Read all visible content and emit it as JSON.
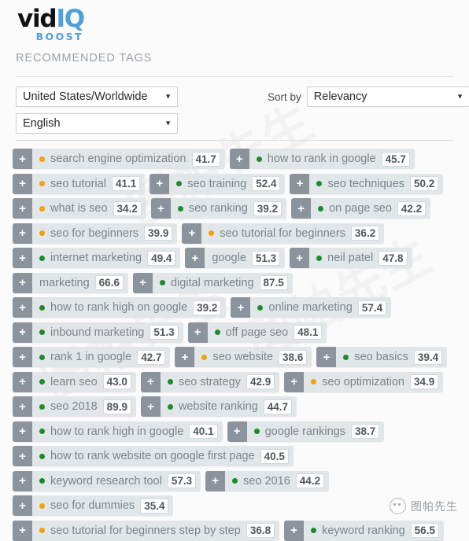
{
  "brand": {
    "logo_vid": "vid",
    "logo_iq": "IQ",
    "logo_boost": "BOOST",
    "accent_color": "#4f9fda"
  },
  "section": {
    "title": "RECOMMENDED TAGS"
  },
  "filters": {
    "region_value": "United States/Worldwide",
    "language_value": "English",
    "sort_label": "Sort by",
    "sort_value": "Relevancy",
    "caret_icon": "chevron-down-icon"
  },
  "tag_colors": {
    "green": "#1d8a2b",
    "orange": "#f0a010",
    "chip_bg": "#e1e6e9",
    "add_bg": "#8b949c"
  },
  "add_icon_glyph": "+",
  "tag_rows": [
    [
      {
        "label": "search engine optimization",
        "score": "41.7",
        "dot": "orange"
      },
      {
        "label": "how to rank in google",
        "score": "45.7",
        "dot": "green"
      }
    ],
    [
      {
        "label": "seo tutorial",
        "score": "41.1",
        "dot": "orange"
      },
      {
        "label": "seo training",
        "score": "52.4",
        "dot": "green"
      },
      {
        "label": "seo techniques",
        "score": "50.2",
        "dot": "green"
      }
    ],
    [
      {
        "label": "what is seo",
        "score": "34.2",
        "dot": "orange"
      },
      {
        "label": "seo ranking",
        "score": "39.2",
        "dot": "green"
      },
      {
        "label": "on page seo",
        "score": "42.2",
        "dot": "green"
      }
    ],
    [
      {
        "label": "seo for beginners",
        "score": "39.9",
        "dot": "orange"
      },
      {
        "label": "seo tutorial for beginners",
        "score": "36.2",
        "dot": "orange"
      }
    ],
    [
      {
        "label": "internet marketing",
        "score": "49.4",
        "dot": "green"
      },
      {
        "label": "google",
        "score": "51.3",
        "dot": "none"
      },
      {
        "label": "neil patel",
        "score": "47.8",
        "dot": "green"
      }
    ],
    [
      {
        "label": "marketing",
        "score": "66.6",
        "dot": "none"
      },
      {
        "label": "digital marketing",
        "score": "87.5",
        "dot": "green"
      }
    ],
    [
      {
        "label": "how to rank high on google",
        "score": "39.2",
        "dot": "green"
      },
      {
        "label": "online marketing",
        "score": "57.4",
        "dot": "green"
      }
    ],
    [
      {
        "label": "inbound marketing",
        "score": "51.3",
        "dot": "green"
      },
      {
        "label": "off page seo",
        "score": "48.1",
        "dot": "green"
      }
    ],
    [
      {
        "label": "rank 1 in google",
        "score": "42.7",
        "dot": "green"
      },
      {
        "label": "seo website",
        "score": "38.6",
        "dot": "orange"
      },
      {
        "label": "seo basics",
        "score": "39.4",
        "dot": "green"
      }
    ],
    [
      {
        "label": "learn seo",
        "score": "43.0",
        "dot": "green"
      },
      {
        "label": "seo strategy",
        "score": "42.9",
        "dot": "green"
      },
      {
        "label": "seo optimization",
        "score": "34.9",
        "dot": "orange"
      }
    ],
    [
      {
        "label": "seo 2018",
        "score": "89.9",
        "dot": "green"
      },
      {
        "label": "website ranking",
        "score": "44.7",
        "dot": "green"
      }
    ],
    [
      {
        "label": "how to rank high in google",
        "score": "40.1",
        "dot": "green"
      },
      {
        "label": "google rankings",
        "score": "38.7",
        "dot": "green"
      }
    ],
    [
      {
        "label": "how to rank website on google first page",
        "score": "40.5",
        "dot": "green"
      }
    ],
    [
      {
        "label": "keyword research tool",
        "score": "57.3",
        "dot": "green"
      },
      {
        "label": "seo 2016",
        "score": "44.2",
        "dot": "green"
      }
    ],
    [
      {
        "label": "seo for dummies",
        "score": "35.4",
        "dot": "orange"
      }
    ],
    [
      {
        "label": "seo tutorial for beginners step by step",
        "score": "36.8",
        "dot": "orange"
      },
      {
        "label": "keyword ranking",
        "score": "56.5",
        "dot": "green"
      }
    ]
  ],
  "watermark": {
    "text": "图帕先生",
    "background_text": "图帕先生"
  }
}
